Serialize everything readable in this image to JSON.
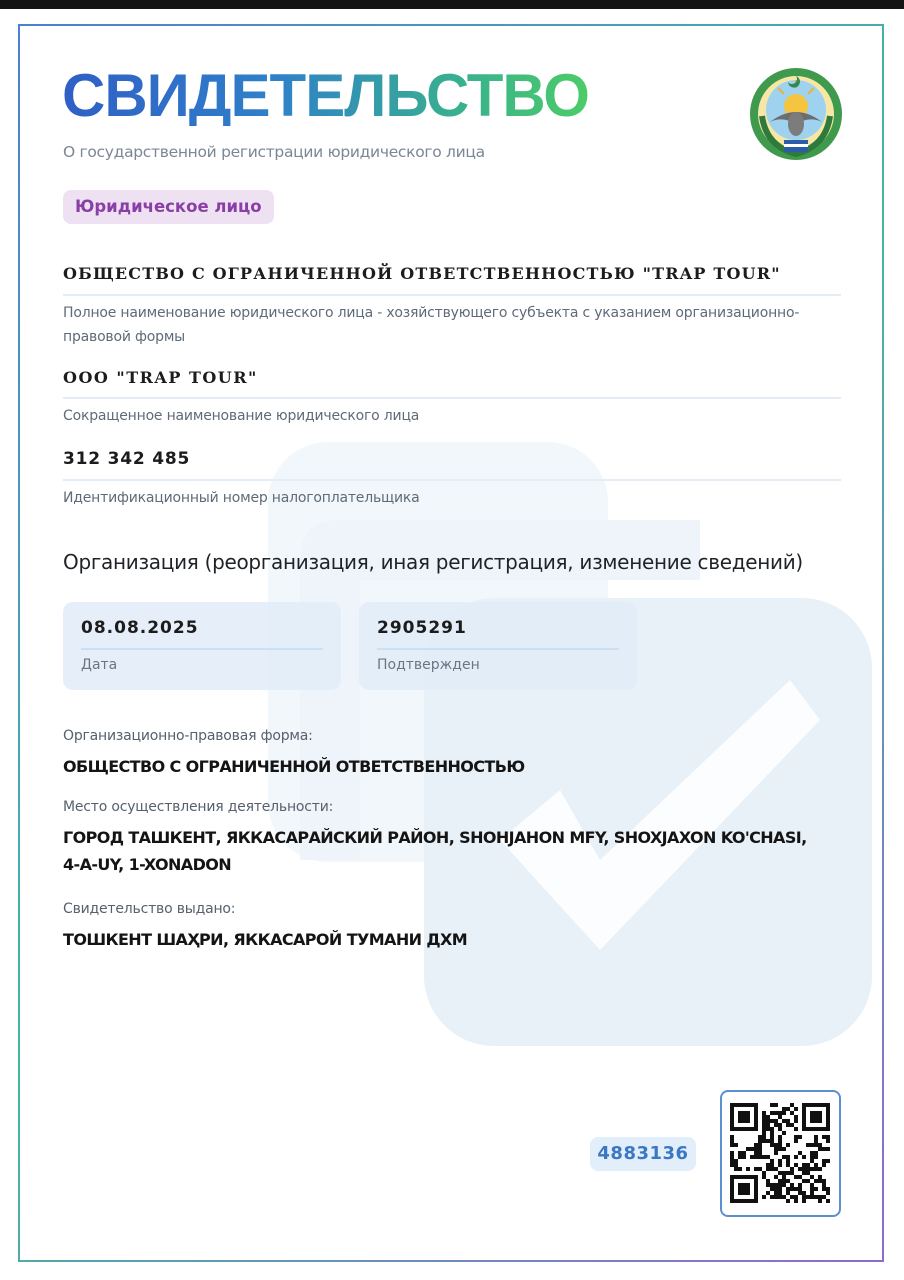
{
  "document": {
    "title": "СВИДЕТЕЛЬСТВО",
    "subtitle": "О государственной регистрации юридического лица",
    "entity_type_badge": "Юридическое лицо"
  },
  "fields": {
    "full_name": {
      "value": "ОБЩЕСТВО С ОГРАНИЧЕННОЙ ОТВЕТСТВЕННОСТЬЮ \"TRAP TOUR\"",
      "caption": "Полное наименование юридического лица - хозяйствующего субъекта с указанием организационно-правовой формы"
    },
    "short_name": {
      "value": "ООО \"TRAP TOUR\"",
      "caption": "Сокращенное наименование юридического лица"
    },
    "tax_id": {
      "value": "312 342 485",
      "caption": "Идентификационный номер налогоплательщика"
    }
  },
  "registration": {
    "section_title": "Организация (реорганизация, иная регистрация, изменение сведений)",
    "date": {
      "value": "08.08.2025",
      "label": "Дата"
    },
    "confirmation": {
      "value": "2905291",
      "label": "Подтвержден"
    }
  },
  "details": {
    "legal_form": {
      "label": "Организационно-правовая форма:",
      "value": "ОБЩЕСТВО С ОГРАНИЧЕННОЙ ОТВЕТСТВЕННОСТЬЮ"
    },
    "address": {
      "label": "Место осуществления деятельности:",
      "value_line1": "ГОРОД ТАШКЕНТ, ЯККАСАРАЙСКИЙ РАЙОН, SHOHJAHON MFY, SHOXJAXON KO'CHASI,",
      "value_line2": "4-A-UY, 1-XONADON"
    },
    "issued_by": {
      "label": "Свидетельство выдано:",
      "value": "ТОШКЕНТ ШАҲРИ, ЯККАСАРОЙ ТУМАНИ ДХМ"
    }
  },
  "footer": {
    "registration_number": "4883136"
  },
  "icons": {
    "emblem": "uzbekistan-state-emblem",
    "qr": "qr-code",
    "watermark": "checkmark-watermark"
  },
  "colors": {
    "title_gradient_start": "#2f5fc6",
    "title_gradient_end": "#4ccc68",
    "badge_bg": "#ede1f2",
    "badge_text": "#8a3fa6",
    "accent_blue": "#3b78c3"
  }
}
